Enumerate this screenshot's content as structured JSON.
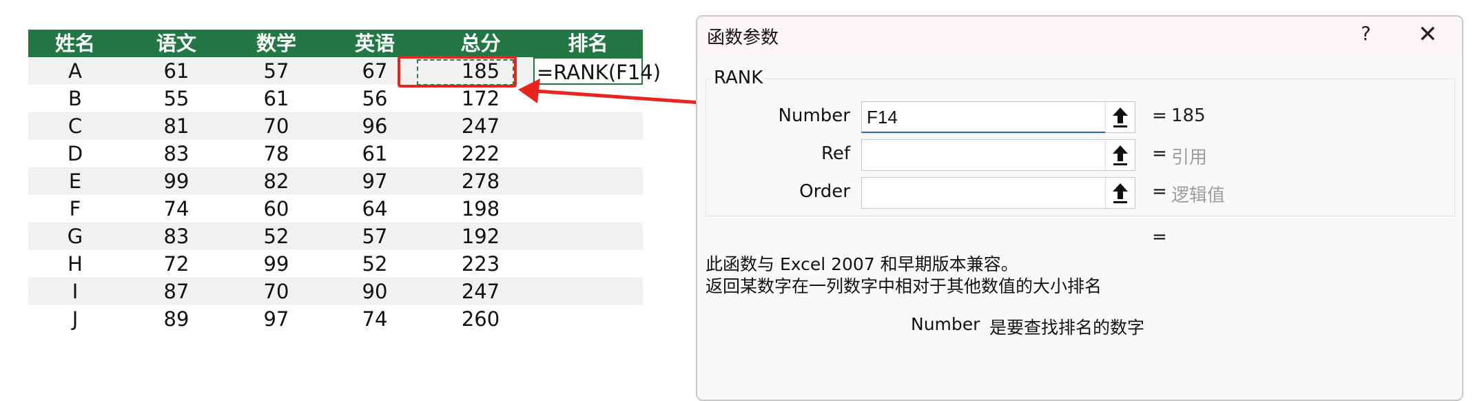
{
  "sheet": {
    "headers": [
      "姓名",
      "语文",
      "数学",
      "英语",
      "总分",
      "排名"
    ],
    "rows": [
      [
        "A",
        "61",
        "57",
        "67",
        "185",
        "=RANK(F14)"
      ],
      [
        "B",
        "55",
        "61",
        "56",
        "172",
        ""
      ],
      [
        "C",
        "81",
        "70",
        "96",
        "247",
        ""
      ],
      [
        "D",
        "83",
        "78",
        "61",
        "222",
        ""
      ],
      [
        "E",
        "99",
        "82",
        "97",
        "278",
        ""
      ],
      [
        "F",
        "74",
        "60",
        "64",
        "198",
        ""
      ],
      [
        "G",
        "83",
        "52",
        "57",
        "192",
        ""
      ],
      [
        "H",
        "72",
        "99",
        "52",
        "223",
        ""
      ],
      [
        "I",
        "87",
        "70",
        "90",
        "247",
        ""
      ],
      [
        "J",
        "89",
        "97",
        "74",
        "260",
        ""
      ]
    ],
    "header_color": "#237744",
    "band_color": "#f1f1f1",
    "highlight_color": "#e8241d"
  },
  "dialog": {
    "title": "函数参数",
    "help_label": "?",
    "close_label": "✕",
    "function_name": "RANK",
    "args": [
      {
        "label": "Number",
        "value": "F14",
        "result": "= 185",
        "result_value": "185"
      },
      {
        "label": "Ref",
        "value": "",
        "result_value": "引用"
      },
      {
        "label": "Order",
        "value": "",
        "result_value": "逻辑值"
      }
    ],
    "equals": "=",
    "result_equals": "=",
    "description_line1": "此函数与 Excel 2007 和早期版本兼容。",
    "description_line2": "返回某数字在一列数字中相对于其他数值的大小排名",
    "param_name": "Number",
    "param_description": "是要查找排名的数字",
    "ref_icon": "upload-arrow-icon"
  }
}
